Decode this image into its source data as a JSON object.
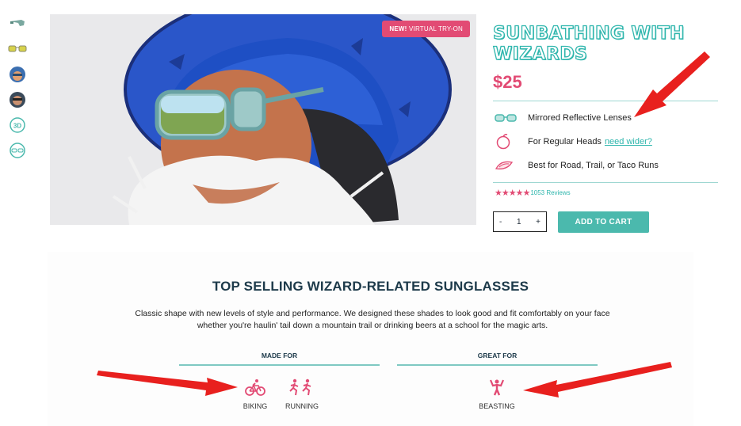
{
  "hero": {
    "badge_bold": "NEW!",
    "badge_text": " VIRTUAL TRY-ON"
  },
  "product": {
    "title": "SUNBATHING WITH WIZARDS",
    "price": "$25",
    "features": [
      {
        "icon": "sunglasses-icon",
        "text": "Mirrored Reflective Lenses"
      },
      {
        "icon": "head-icon",
        "text": "For Regular Heads",
        "link": "need wider?"
      },
      {
        "icon": "taco-icon",
        "text": "Best for Road, Trail, or Taco Runs"
      }
    ],
    "reviews": "1053 Reviews",
    "rating": 5,
    "quantity": "1",
    "qty_minus": "-",
    "qty_plus": "+",
    "add_to_cart": "ADD TO CART"
  },
  "section": {
    "title": "TOP SELLING WIZARD-RELATED SUNGLASSES",
    "description": "Classic shape with new levels of style and performance. We designed these shades to look good and fit comfortably on your face whether you're haulin' tail down a mountain trail or drinking beers at a school for the magic arts.",
    "made_for_label": "MADE FOR",
    "great_for_label": "GREAT FOR",
    "made_for": [
      {
        "icon": "biking-icon",
        "label": "BIKING"
      },
      {
        "icon": "running-icon",
        "label": "RUNNING"
      }
    ],
    "great_for": [
      {
        "icon": "beasting-icon",
        "label": "BEASTING"
      }
    ]
  },
  "colors": {
    "accent": "#2fb6ad",
    "brand_pink": "#e24b74",
    "arrow": "#e8201e"
  }
}
